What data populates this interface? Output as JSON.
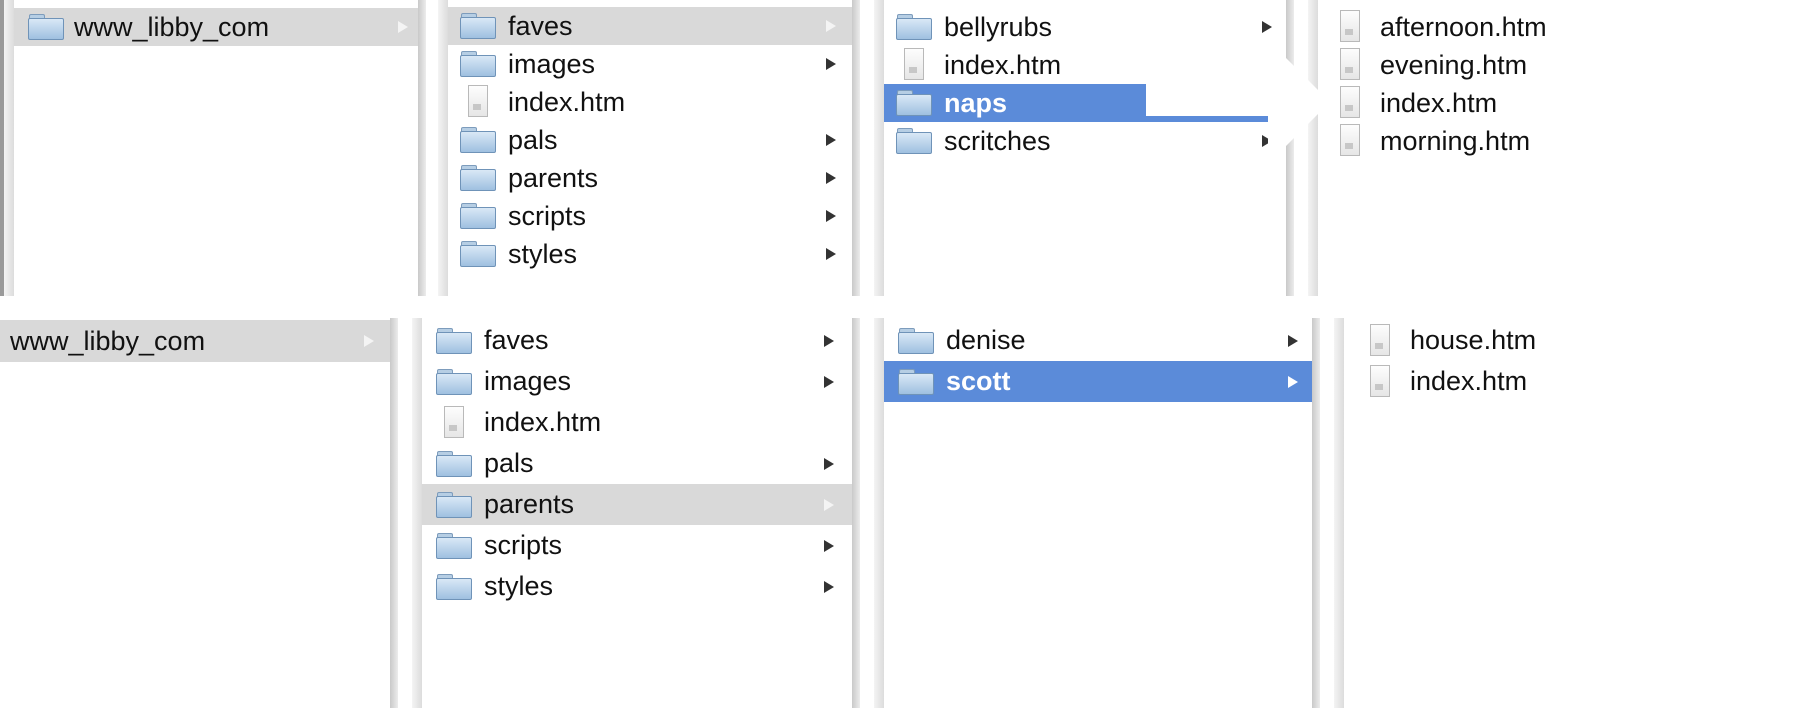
{
  "top": {
    "root": "www_libby_com",
    "site_items": [
      {
        "label": "faves",
        "type": "folder"
      },
      {
        "label": "images",
        "type": "folder"
      },
      {
        "label": "index.htm",
        "type": "file"
      },
      {
        "label": "pals",
        "type": "folder"
      },
      {
        "label": "parents",
        "type": "folder"
      },
      {
        "label": "scripts",
        "type": "folder"
      },
      {
        "label": "styles",
        "type": "folder"
      }
    ],
    "faves_items": [
      {
        "label": "bellyrubs",
        "type": "folder"
      },
      {
        "label": "index.htm",
        "type": "file"
      },
      {
        "label": "naps",
        "type": "folder"
      },
      {
        "label": "scritches",
        "type": "folder"
      }
    ],
    "naps_items": [
      {
        "label": "afternoon.htm",
        "type": "file"
      },
      {
        "label": "evening.htm",
        "type": "file"
      },
      {
        "label": "index.htm",
        "type": "file"
      },
      {
        "label": "morning.htm",
        "type": "file"
      }
    ]
  },
  "bottom": {
    "root": "www_libby_com",
    "site_items": [
      {
        "label": "faves",
        "type": "folder"
      },
      {
        "label": "images",
        "type": "folder"
      },
      {
        "label": "index.htm",
        "type": "file"
      },
      {
        "label": "pals",
        "type": "folder"
      },
      {
        "label": "parents",
        "type": "folder"
      },
      {
        "label": "scripts",
        "type": "folder"
      },
      {
        "label": "styles",
        "type": "folder"
      }
    ],
    "parents_items": [
      {
        "label": "denise",
        "type": "folder"
      },
      {
        "label": "scott",
        "type": "folder"
      }
    ],
    "scott_items": [
      {
        "label": "house.htm",
        "type": "file"
      },
      {
        "label": "index.htm",
        "type": "file"
      }
    ]
  },
  "icons": {
    "folder": "folder-icon",
    "file": "file-icon",
    "disclosure": "disclosure-arrow-icon"
  },
  "colors": {
    "selection_blue": "#5b8bd9",
    "selection_gray": "#d9d9d9",
    "separator": "#dcdcdc"
  }
}
